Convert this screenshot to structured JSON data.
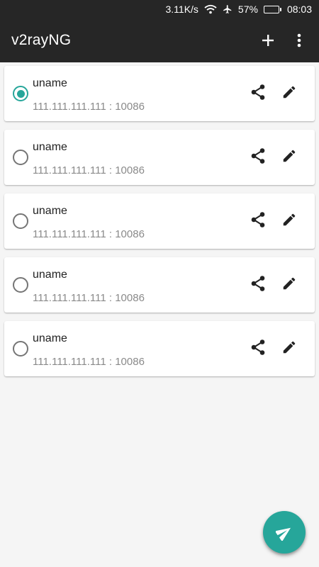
{
  "status_bar": {
    "net_speed": "3.11K/s",
    "battery": "57%",
    "battery_level": 0.57,
    "time": "08:03",
    "icons": [
      "wifi-icon",
      "airplane-icon",
      "battery-icon"
    ]
  },
  "app_bar": {
    "title": "v2rayNG",
    "actions": [
      "add-icon",
      "more-vert-icon"
    ]
  },
  "servers": [
    {
      "name": "uname",
      "address": "111.111.111.111 : 10086",
      "selected": true
    },
    {
      "name": "uname",
      "address": "111.111.111.111 : 10086",
      "selected": false
    },
    {
      "name": "uname",
      "address": "111.111.111.111 : 10086",
      "selected": false
    },
    {
      "name": "uname",
      "address": "111.111.111.111 : 10086",
      "selected": false
    },
    {
      "name": "uname",
      "address": "111.111.111.111 : 10086",
      "selected": false
    }
  ],
  "fab": {
    "icon": "send-icon"
  },
  "colors": {
    "app_bar": "#262626",
    "accent": "#26a69a",
    "background": "#f5f5f5",
    "card": "#ffffff",
    "secondary_text": "#8a8a8a"
  }
}
